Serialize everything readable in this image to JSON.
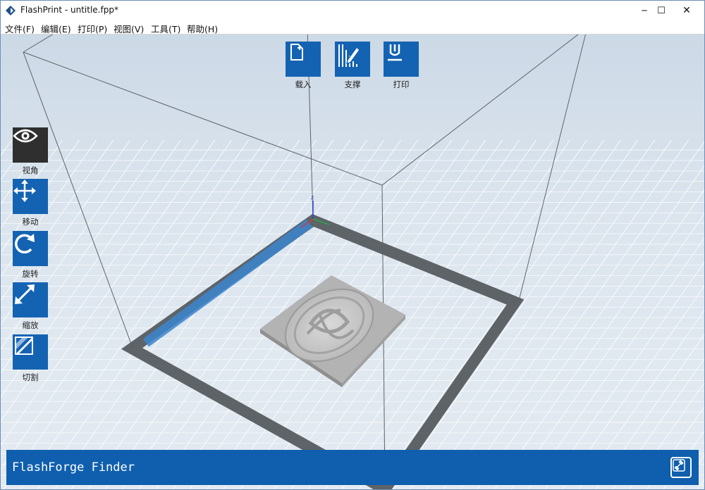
{
  "window": {
    "title": "FlashPrint - untitle.fpp*",
    "minimize_symbol": "─",
    "maximize_symbol": "☐",
    "close_symbol": "✕"
  },
  "menu": [
    {
      "label": "文件(F)"
    },
    {
      "label": "编辑(E)"
    },
    {
      "label": "打印(P)"
    },
    {
      "label": "视图(V)"
    },
    {
      "label": "工具(T)"
    },
    {
      "label": "帮助(H)"
    }
  ],
  "top_toolbar": {
    "load": {
      "label": "载入",
      "icon": "load-file-icon"
    },
    "support": {
      "label": "支撑",
      "icon": "support-icon"
    },
    "print": {
      "label": "打印",
      "icon": "print-icon"
    }
  },
  "side_toolbar": {
    "view": {
      "label": "视角",
      "icon": "eye-icon",
      "active": true
    },
    "move": {
      "label": "移动",
      "icon": "move-arrows-icon"
    },
    "rotate": {
      "label": "旋转",
      "icon": "rotate-icon"
    },
    "scale": {
      "label": "缩放",
      "icon": "scale-icon"
    },
    "cut": {
      "label": "切割",
      "icon": "cut-icon"
    }
  },
  "axes": {
    "z_label": "z"
  },
  "status_bar": {
    "text": "FlashForge Finder",
    "connect_icon": "connect-printer-icon"
  },
  "colors": {
    "accent": "#1463b3",
    "active_tool": "#2f2f2f",
    "status_bar": "#0f5fae",
    "build_plate_border": "#4f5458",
    "build_plate_highlight": "#3d86cf"
  }
}
